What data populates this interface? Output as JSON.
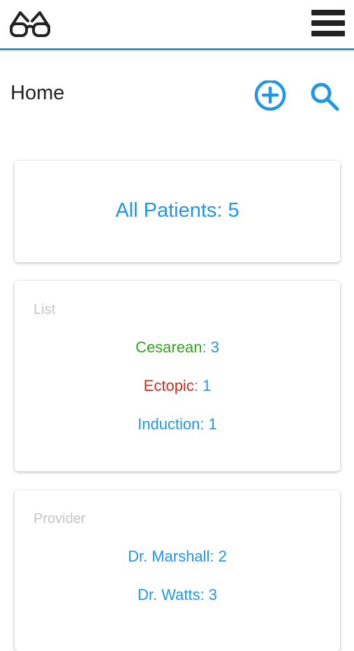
{
  "colors": {
    "accent": "#2196e8",
    "cesarean": "#2ea81b",
    "ectopic": "#d42b1e",
    "label_gray": "#c4c4c4"
  },
  "topbar": {
    "logo_icon": "glasses-icon",
    "menu_icon": "hamburger-menu-icon"
  },
  "header": {
    "title": "Home",
    "add_icon": "plus-circle-icon",
    "search_icon": "search-icon"
  },
  "all_patients": {
    "label": "All Patients: 5"
  },
  "list_card": {
    "label": "List",
    "items": [
      {
        "name": "Cesarean",
        "separator": ": ",
        "count": "3"
      },
      {
        "name": "Ectopic",
        "separator": ": ",
        "count": "1"
      },
      {
        "name": "Induction",
        "separator": ": ",
        "count": "1"
      }
    ]
  },
  "provider_card": {
    "label": "Provider",
    "items": [
      {
        "text": "Dr. Marshall: 2"
      },
      {
        "text": "Dr. Watts: 3"
      }
    ]
  }
}
